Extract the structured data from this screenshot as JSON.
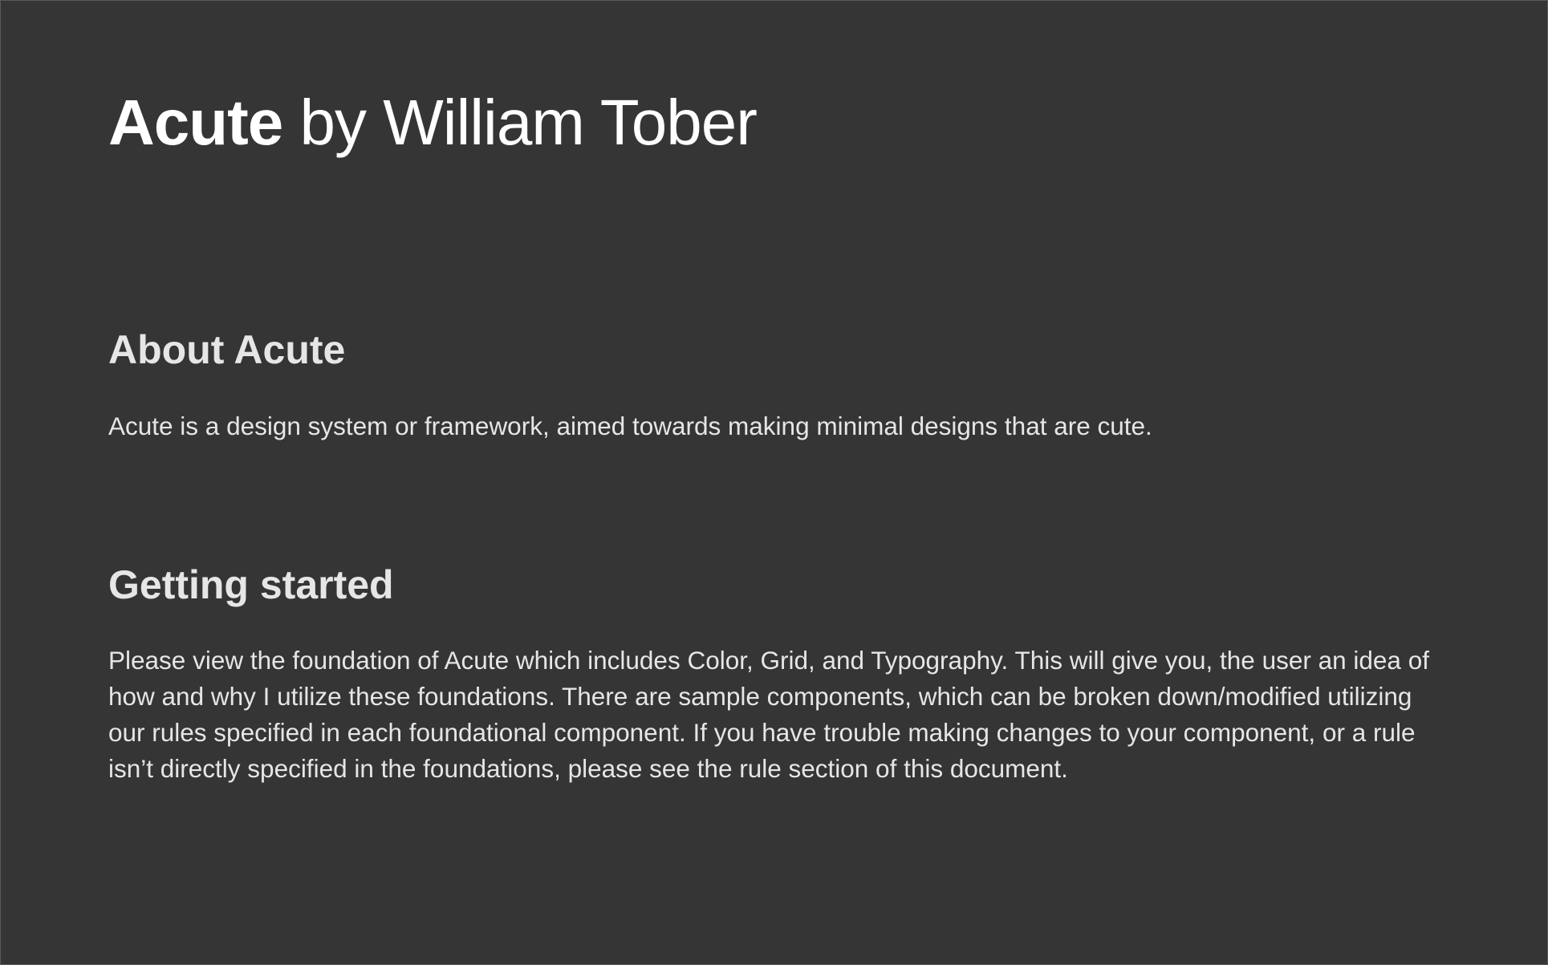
{
  "header": {
    "title_bold": "Acute",
    "title_light": " by William Tober"
  },
  "about": {
    "heading": "About Acute",
    "text": "Acute is a design system or framework, aimed towards making minimal designs that are cute."
  },
  "getting_started": {
    "heading": "Getting started",
    "lines": [
      "Please view the foundation of Acute which includes Color, Grid, and Typography. This will give you, the user an idea of",
      "how and why I utilize these foundations. There are sample components, which can be broken down/modified utilizing",
      "our rules specified in each foundational component. If you have trouble making changes to your component, or a rule",
      "isn’t directly specified in the foundations, please see the rule section of this document."
    ]
  },
  "colors": {
    "background": "#353535",
    "title_text": "#ffffff",
    "body_text": "#e6e6e6"
  }
}
